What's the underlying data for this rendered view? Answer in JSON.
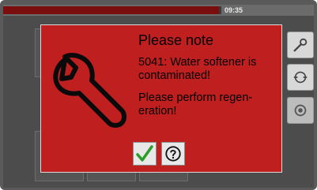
{
  "status_bar": {
    "clock": "09:35",
    "progress_fraction": 0.99
  },
  "dialog": {
    "title": "Please note",
    "message": "5041: Water softener is contaminated!",
    "instruction": "Please perform regen-eration!",
    "icon": "wrench-icon",
    "buttons": {
      "confirm_icon": "checkmark-icon",
      "help_icon": "help-icon"
    }
  },
  "side_buttons": [
    {
      "icon": "wrench-icon"
    },
    {
      "icon": "rinse-cycle-icon"
    },
    {
      "icon": "settings-icon"
    }
  ],
  "colors": {
    "dialog_background": "#bf1f1f",
    "progress": "#7a0d0d",
    "confirm_check": "#2a9d2a"
  }
}
